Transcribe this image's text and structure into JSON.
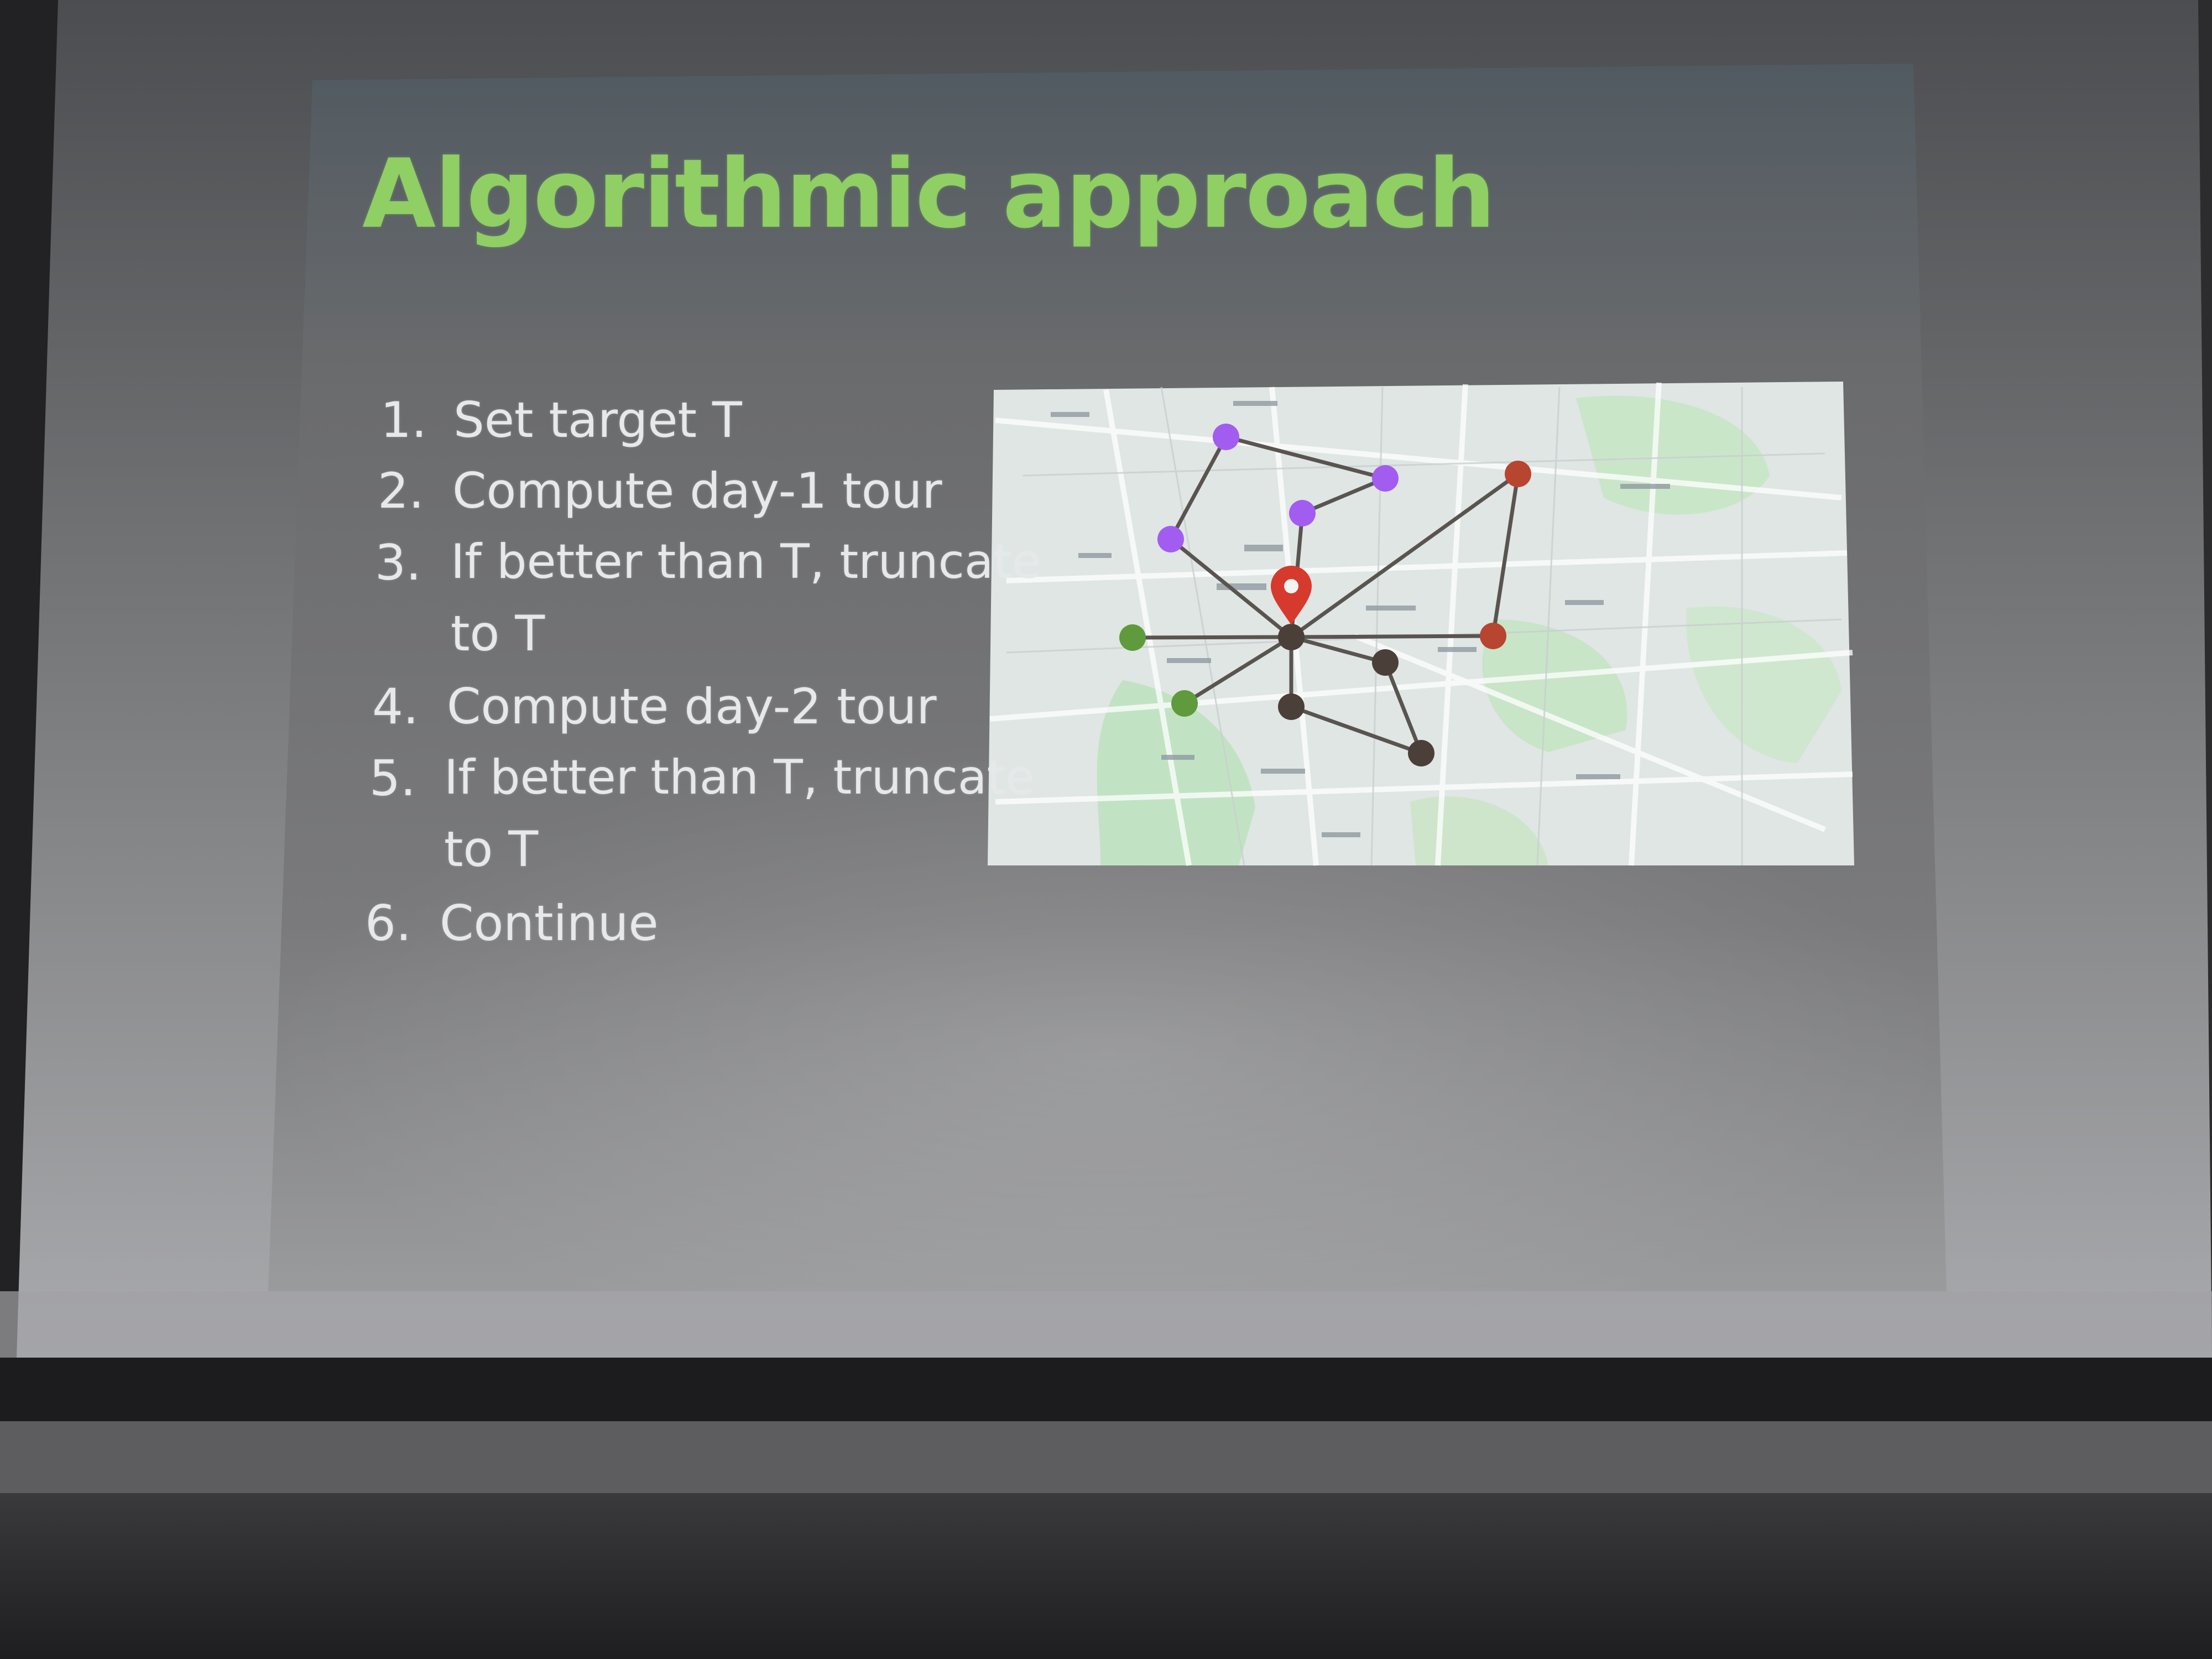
{
  "slide": {
    "title": "Algorithmic approach",
    "steps": [
      {
        "number": "1.",
        "lines": [
          "Set target T"
        ]
      },
      {
        "number": "2.",
        "lines": [
          "Compute day-1 tour"
        ]
      },
      {
        "number": "3.",
        "lines": [
          "If better than T, truncate",
          "to T"
        ]
      },
      {
        "number": "4.",
        "lines": [
          "Compute day-2 tour"
        ]
      },
      {
        "number": "5.",
        "lines": [
          "If better than T, truncate",
          "to T"
        ]
      },
      {
        "number": "6.",
        "lines": [
          "Continue"
        ]
      }
    ]
  },
  "map": {
    "node_colors": {
      "purple": "#a35cf0",
      "green": "#5f9a3c",
      "dark": "#4a3f39",
      "red": "#b8452f",
      "pin": "#d63a2c"
    },
    "icons": [
      "location-pin-icon"
    ]
  },
  "colors": {
    "title": "#8fcf63",
    "body_text": "#e6e8ea",
    "slide_background": "#6b6e72",
    "room_dark": "#2f2f31"
  }
}
